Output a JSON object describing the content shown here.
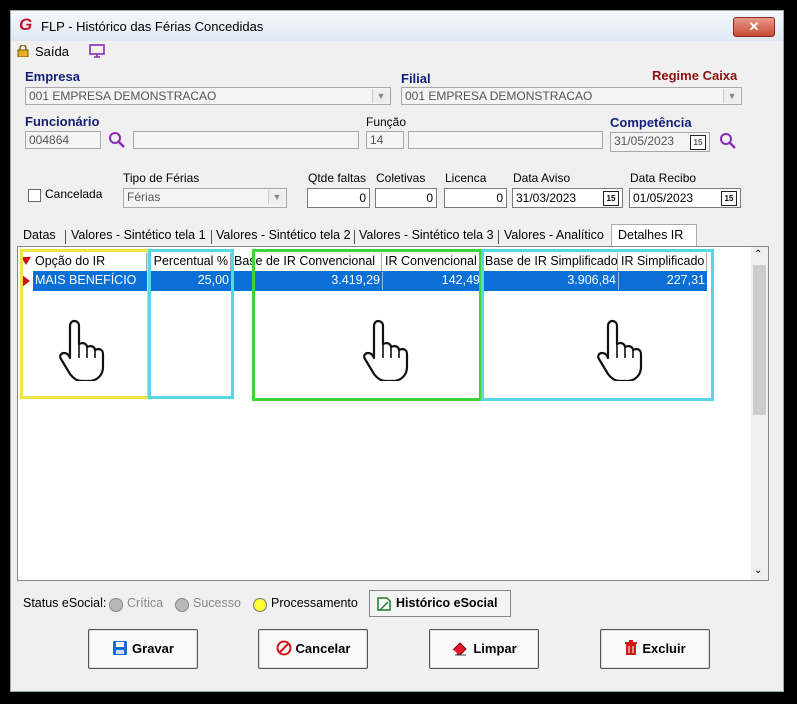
{
  "window": {
    "title": "FLP - Histórico das Férias Concedidas",
    "close_label": "✕"
  },
  "toolbar": {
    "exit_label": "Saída"
  },
  "form": {
    "empresa_label": "Empresa",
    "empresa_value": "001 EMPRESA DEMONSTRACAO",
    "filial_label": "Filial",
    "filial_value": "001 EMPRESA DEMONSTRACAO",
    "regime_label": "Regime Caixa",
    "funcionario_label": "Funcionário",
    "funcionario_code": "004864",
    "funcionario_name": "",
    "funcao_label": "Função",
    "funcao_code": "14",
    "funcao_name": "",
    "competencia_label": "Competência",
    "competencia_value": "31/05/2023",
    "cancelada_label": "Cancelada",
    "tipo_ferias_label": "Tipo de Férias",
    "tipo_ferias_value": "Férias",
    "qtde_faltas_label": "Qtde faltas",
    "qtde_faltas_value": "0",
    "coletivas_label": "Coletivas",
    "coletivas_value": "0",
    "licenca_label": "Licenca",
    "licenca_value": "0",
    "data_aviso_label": "Data Aviso",
    "data_aviso_value": "31/03/2023",
    "data_recibo_label": "Data Recibo",
    "data_recibo_value": "01/05/2023",
    "calendar_glyph": "15"
  },
  "tabs": [
    {
      "label": "Datas"
    },
    {
      "label": "Valores - Sintético tela 1"
    },
    {
      "label": "Valores - Sintético tela 2"
    },
    {
      "label": "Valores - Sintético tela 3"
    },
    {
      "label": "Valores - Analítico"
    },
    {
      "label": "Detalhes IR",
      "selected": true
    }
  ],
  "grid": {
    "columns": [
      "Opção do IR",
      "Percentual %",
      "Base de IR Convencional",
      "IR Convencional",
      "Base de IR Simplificado",
      "IR Simplificado"
    ],
    "rows": [
      {
        "opcao": "MAIS BENEFÍCIO",
        "percentual": "25,00",
        "base_conv": "3.419,29",
        "ir_conv": "142,49",
        "base_simp": "3.906,84",
        "ir_simp": "227,31"
      }
    ]
  },
  "status": {
    "label": "Status eSocial:",
    "items": [
      {
        "label": "Crítica",
        "color": "#b8b8b8"
      },
      {
        "label": "Sucesso",
        "color": "#b8b8b8"
      },
      {
        "label": "Processamento",
        "color": "#ffff33"
      }
    ],
    "historico_label": "Histórico eSocial"
  },
  "buttons": {
    "gravar": "Gravar",
    "cancelar": "Cancelar",
    "limpar": "Limpar",
    "excluir": "Excluir"
  },
  "colors": {
    "selection": "#0b6fd8",
    "label_blue": "#16207a",
    "regime_red": "#8b1010",
    "highlight_yellow": "#f2e24a",
    "highlight_cyan": "#54d8e8",
    "highlight_green": "#3ed33e"
  }
}
